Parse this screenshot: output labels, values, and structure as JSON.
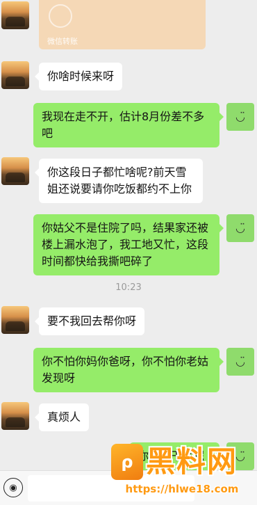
{
  "transfer_card": {
    "label": "微信转账"
  },
  "messages": [
    {
      "side": "in",
      "text": "你啥时候来呀"
    },
    {
      "side": "out",
      "text": "我现在走不开，估计8月份差不多吧"
    },
    {
      "side": "in",
      "text": "你这段日子都忙啥呢?前天雪姐还说要请你吃饭都约不上你"
    },
    {
      "side": "out",
      "text": "你姑父不是住院了吗，结果家还被楼上漏水泡了，我工地又忙，这段时间都快给我撕吧碎了"
    },
    {
      "side": "in",
      "text": "要不我回去帮你呀"
    },
    {
      "side": "out",
      "text": "你不怕你妈你爸呀，你不怕你老姑发现呀"
    },
    {
      "side": "in",
      "text": "真烦人"
    },
    {
      "side": "out",
      "text": "你现在干啥呢"
    }
  ],
  "timestamp": "10:23",
  "self_avatar_glyph": "◡̈",
  "watermark": {
    "logo_glyph": "ρ",
    "title": "黑料网",
    "url": "https://hlwe18.com"
  },
  "icons": {
    "voice": "voice-icon"
  }
}
